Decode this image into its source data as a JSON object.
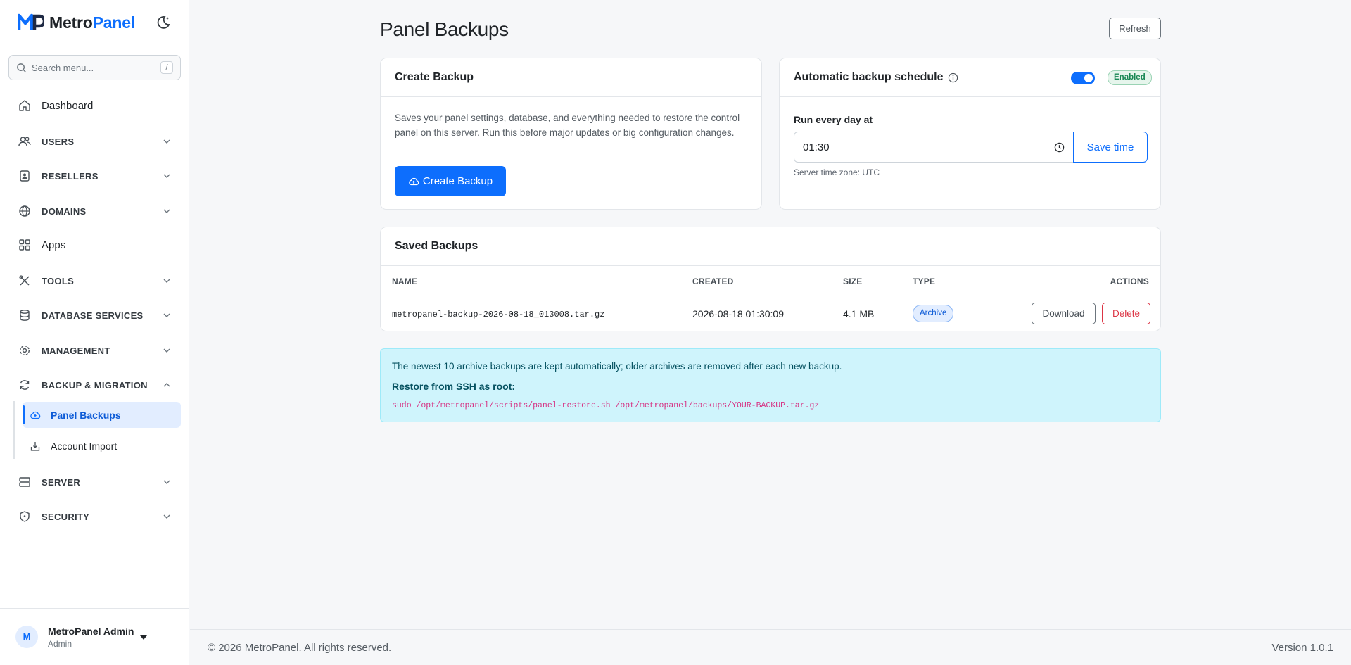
{
  "brand": {
    "name_part1": "Metro",
    "name_part2": "Panel"
  },
  "sidebar": {
    "search_placeholder": "Search menu...",
    "search_shortcut": "/",
    "items": [
      {
        "label": "Dashboard",
        "icon": "home-icon"
      },
      {
        "label": "USERS",
        "icon": "users-icon"
      },
      {
        "label": "RESELLERS",
        "icon": "badge-icon"
      },
      {
        "label": "DOMAINS",
        "icon": "globe-icon"
      },
      {
        "label": "Apps",
        "icon": "grid-icon"
      },
      {
        "label": "TOOLS",
        "icon": "tools-icon"
      },
      {
        "label": "DATABASE SERVICES",
        "icon": "database-icon"
      },
      {
        "label": "MANAGEMENT",
        "icon": "gear-icon"
      },
      {
        "label": "BACKUP & MIGRATION",
        "icon": "refresh-icon"
      },
      {
        "label": "SERVER",
        "icon": "server-icon"
      },
      {
        "label": "SECURITY",
        "icon": "shield-icon"
      }
    ],
    "sub_items": [
      {
        "label": "Panel Backups",
        "active": true
      },
      {
        "label": "Account Import",
        "active": false
      }
    ]
  },
  "user": {
    "initial": "M",
    "name": "MetroPanel Admin",
    "role": "Admin"
  },
  "page": {
    "title": "Panel Backups",
    "refresh_label": "Refresh"
  },
  "create_backup": {
    "title": "Create Backup",
    "description": "Saves your panel settings, database, and everything needed to restore the control panel on this server. Run this before major updates or big configuration changes.",
    "button_label": "Create Backup"
  },
  "schedule": {
    "title": "Automatic backup schedule",
    "enabled": true,
    "status_badge": "Enabled",
    "run_label": "Run every day at",
    "time_value": "01:30",
    "save_label": "Save time",
    "timezone_note": "Server time zone: UTC"
  },
  "saved_backups": {
    "title": "Saved Backups",
    "columns": [
      "NAME",
      "CREATED",
      "SIZE",
      "TYPE",
      "ACTIONS"
    ],
    "rows": [
      {
        "name": "metropanel-backup-2026-08-18_013008.tar.gz",
        "created": "2026-08-18 01:30:09",
        "size": "4.1 MB",
        "type": "Archive",
        "download_label": "Download",
        "delete_label": "Delete"
      }
    ]
  },
  "info_alert": {
    "text": "The newest 10 archive backups are kept automatically; older archives are removed after each new backup.",
    "restore_title": "Restore from SSH as root:",
    "restore_command": "sudo /opt/metropanel/scripts/panel-restore.sh /opt/metropanel/backups/YOUR-BACKUP.tar.gz"
  },
  "footer": {
    "copyright": "© 2026 MetroPanel. All rights reserved.",
    "version": "Version 1.0.1"
  },
  "colors": {
    "primary": "#0d6efd",
    "danger": "#dc3545",
    "success": "#198754",
    "info_bg": "#cff4fc",
    "code": "#d63384"
  }
}
